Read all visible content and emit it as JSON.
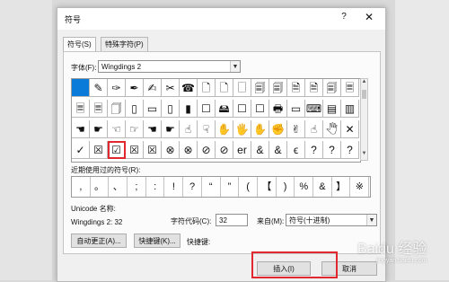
{
  "dialog": {
    "title": "符号",
    "help_label": "?",
    "close_label": "✕",
    "tabs": [
      {
        "label": "符号(S)",
        "active": true
      },
      {
        "label": "特殊字符(P)",
        "active": false
      }
    ],
    "font_label": "字体(F):",
    "font_value": "Wingdings 2",
    "symbol_grid": {
      "rows": [
        [
          "",
          "✎",
          "✑",
          "✒",
          "✍",
          "✂",
          "☎",
          "🗋",
          "🗋",
          "🗌",
          "🗐",
          "🗐",
          "🗎",
          "🗎",
          "🗐",
          "🗏"
        ],
        [
          "🗏",
          "🗏",
          "🗍",
          "▯",
          "▭",
          "▯",
          "▮",
          "☐",
          "🖴",
          "☐",
          "☐",
          "🖶",
          "▭",
          "⌨",
          "▤",
          "▥"
        ],
        [
          "☚",
          "☛",
          "☜",
          "☞",
          "☚",
          "☛",
          "☝",
          "☟",
          "✋",
          "🖐",
          "✋",
          "✊",
          "✌",
          "☝",
          "🖑",
          "✕"
        ],
        [
          "✓",
          "☒",
          "☑",
          "☒",
          "☒",
          "⊗",
          "⊗",
          "⊘",
          "⊘",
          "er",
          "&",
          "&",
          "ϵ",
          "?",
          "?",
          "?"
        ]
      ],
      "selected_symbol": "☑"
    },
    "recent_label": "近期使用过的符号(R):",
    "recent_symbols": [
      ",",
      "。",
      "、",
      ";",
      ":",
      "!",
      "?",
      "“",
      "”",
      "(",
      "【",
      ")",
      "%",
      "&",
      "】",
      "※"
    ],
    "unicode_name_label": "Unicode 名称:",
    "unicode_name_value": "Wingdings 2: 32",
    "char_code_label": "字符代码(C):",
    "char_code_value": "32",
    "from_label": "来自(M):",
    "from_value": "符号(十进制)",
    "autocorrect_label": "自动更正(A)...",
    "shortcut_btn_label": "快捷键(K)...",
    "shortcut_label": "快捷键:",
    "insert_label": "插入(I)",
    "cancel_label": "取消"
  },
  "watermark": {
    "text": "Baidu 经验",
    "sub": "jingyan.baidu.com"
  },
  "colors": {
    "selection": "#0a7bd8",
    "highlight": "#e0282e"
  }
}
